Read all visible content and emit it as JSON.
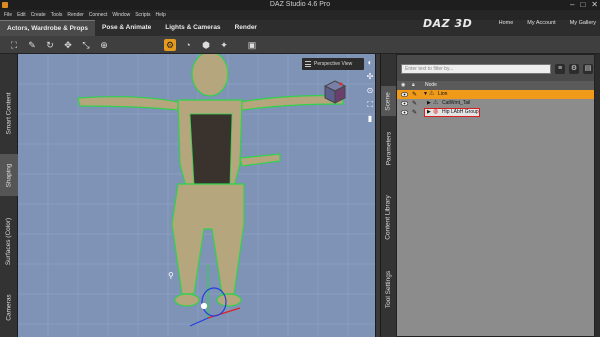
{
  "window": {
    "title": "DAZ Studio 4.6 Pro",
    "buttons": [
      "–",
      "□",
      "✕"
    ]
  },
  "menu": [
    "File",
    "Edit",
    "Create",
    "Tools",
    "Render",
    "Connect",
    "Window",
    "Scripts",
    "Help"
  ],
  "brand": "DAZ 3D",
  "topnav": [
    "Home",
    "My Account",
    "My Gallery"
  ],
  "rooms": [
    {
      "label": "Actors, Wardrobe & Props",
      "active": true
    },
    {
      "label": "Pose & Animate",
      "active": false
    },
    {
      "label": "Lights & Cameras",
      "active": false
    },
    {
      "label": "Render",
      "active": false
    }
  ],
  "tools": [
    "figure-tool-icon",
    "pose-tool-icon",
    "rotate-tool-icon",
    "move-tool-icon",
    "scale-tool-icon",
    "node-tool-icon",
    "joint-editor-icon",
    "surface-tool-icon",
    "geometry-tool-icon",
    "render-icon"
  ],
  "left_tabs": [
    {
      "label": "Smart Content",
      "active": false
    },
    {
      "label": "Shaping",
      "active": true
    },
    {
      "label": "Surfaces (Color)",
      "active": false
    },
    {
      "label": "Cameras",
      "active": false
    }
  ],
  "viewport": {
    "camera": "Perspective View",
    "background": "#7f93b7"
  },
  "right_tabs": [
    {
      "label": "Scene",
      "active": true
    },
    {
      "label": "Parameters",
      "active": false
    },
    {
      "label": "Content Library",
      "active": false
    },
    {
      "label": "Tool Settings",
      "active": false
    }
  ],
  "scene": {
    "filter_placeholder": "Enter text to filter by...",
    "column_node": "Node",
    "nodes": [
      {
        "label": "Lion",
        "level": 0,
        "selected": true
      },
      {
        "label": "CatWmt_Tail",
        "level": 1,
        "selected": false
      },
      {
        "label": "Hip LAbH Group",
        "level": 1,
        "selected": false,
        "highlighted": true
      }
    ]
  },
  "colors": {
    "accent": "#f09a1a",
    "highlight_border": "#d81f1f",
    "wireframe": "#2fd34a"
  }
}
